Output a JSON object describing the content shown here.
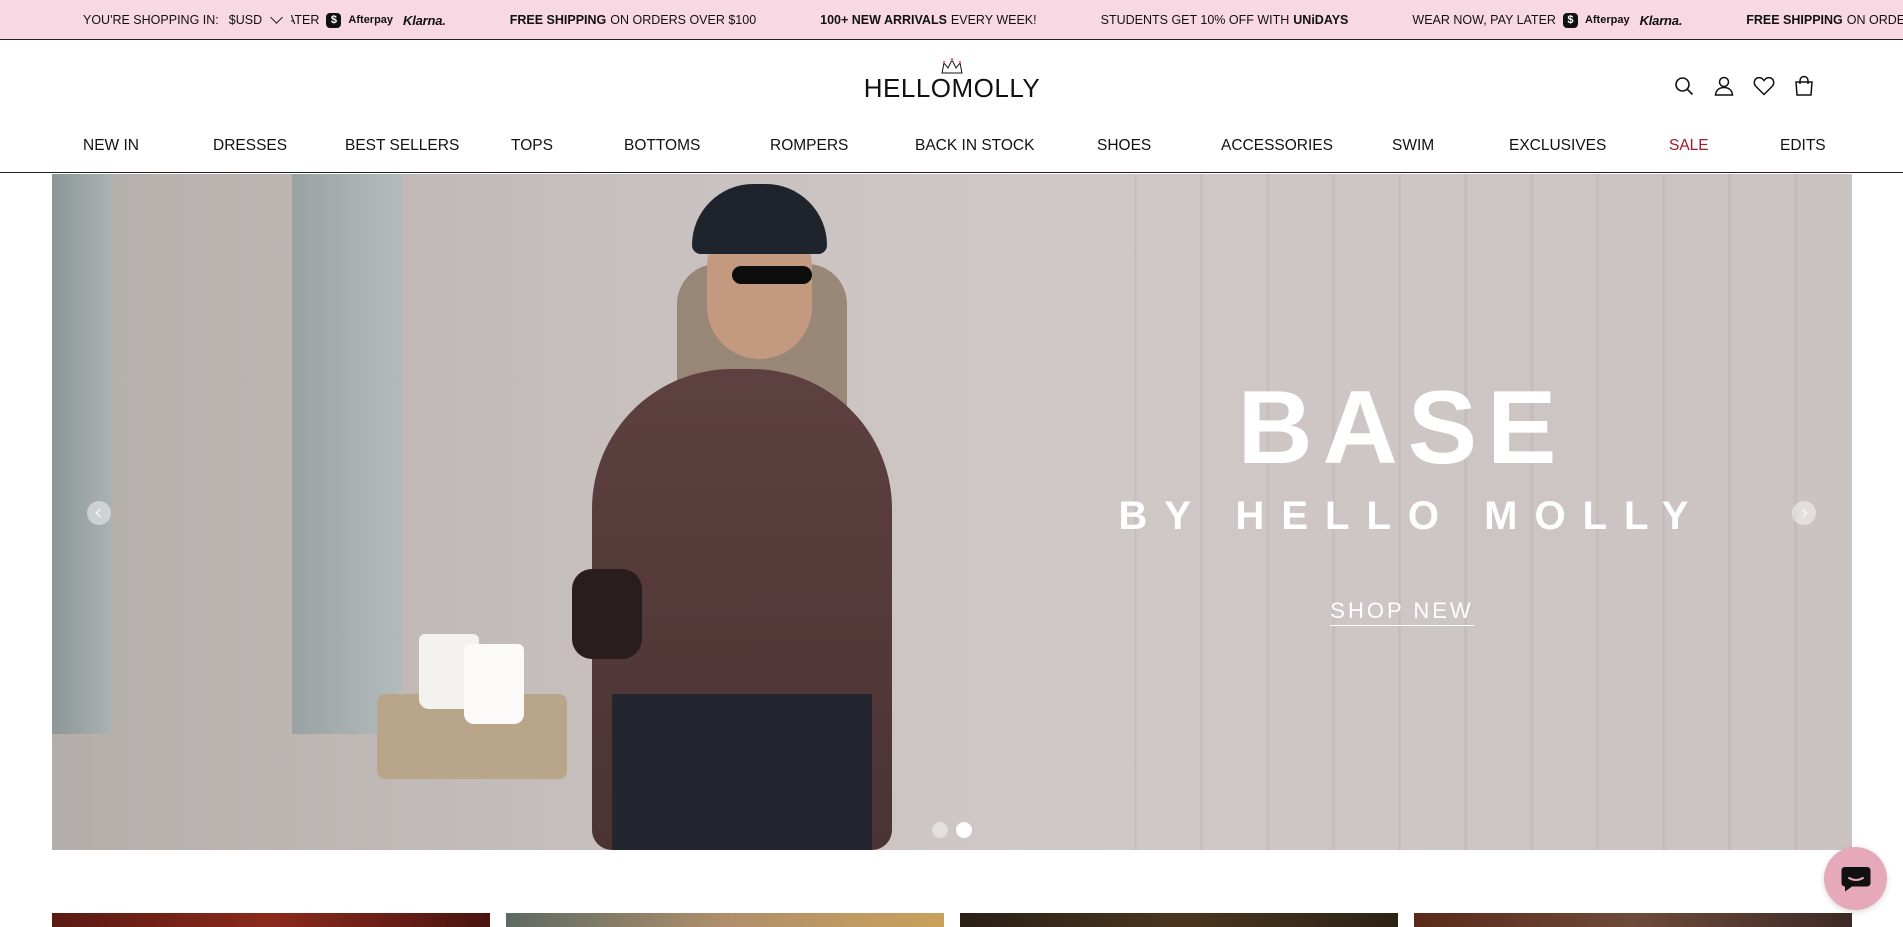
{
  "announcement": {
    "currency_label": "YOU'RE SHOPPING IN:",
    "currency_value": "$USD",
    "items": [
      {
        "pre": "",
        "bold": "",
        "post": "ATER",
        "afterpay": true,
        "klarna": true
      },
      {
        "pre": "",
        "bold": "FREE SHIPPING",
        "post": "ON ORDERS OVER $100",
        "afterpay": false,
        "klarna": false
      },
      {
        "pre": "",
        "bold": "100+ NEW ARRIVALS",
        "post": "EVERY WEEK!",
        "afterpay": false,
        "klarna": false
      },
      {
        "pre": "STUDENTS GET 10% OFF WITH",
        "bold": "UNiDAYS",
        "post": "",
        "afterpay": false,
        "klarna": false
      },
      {
        "pre": "WEAR NOW, PAY LATER",
        "bold": "",
        "post": "",
        "afterpay": true,
        "klarna": true
      },
      {
        "pre": "",
        "bold": "FREE SHIPPING",
        "post": "ON ORDERS O",
        "afterpay": false,
        "klarna": false
      }
    ],
    "afterpay_text": "Afterpay",
    "afterpay_badge": "$",
    "klarna_text": "Klarna."
  },
  "header": {
    "logo_text": "HELLOMOLLY",
    "icons": [
      "search-icon",
      "account-icon",
      "wishlist-icon",
      "cart-icon"
    ]
  },
  "nav": {
    "items": [
      {
        "label": "NEW IN",
        "sale": false
      },
      {
        "label": "DRESSES",
        "sale": false
      },
      {
        "label": "BEST SELLERS",
        "sale": false
      },
      {
        "label": "TOPS",
        "sale": false
      },
      {
        "label": "BOTTOMS",
        "sale": false
      },
      {
        "label": "ROMPERS",
        "sale": false
      },
      {
        "label": "BACK IN STOCK",
        "sale": false
      },
      {
        "label": "SHOES",
        "sale": false
      },
      {
        "label": "ACCESSORIES",
        "sale": false
      },
      {
        "label": "SWIM",
        "sale": false
      },
      {
        "label": "EXCLUSIVES",
        "sale": false
      },
      {
        "label": "SALE",
        "sale": true
      },
      {
        "label": "EDITS",
        "sale": false
      }
    ],
    "sale_color": "#a3192a"
  },
  "hero": {
    "title": "BASE",
    "subtitle": "BY HELLO MOLLY",
    "cta": "SHOP NEW",
    "slide_count": 2,
    "active_slide": 2
  },
  "colors": {
    "announcement_bg": "#f8d9e3",
    "chat_bg": "#e6a8bb"
  }
}
